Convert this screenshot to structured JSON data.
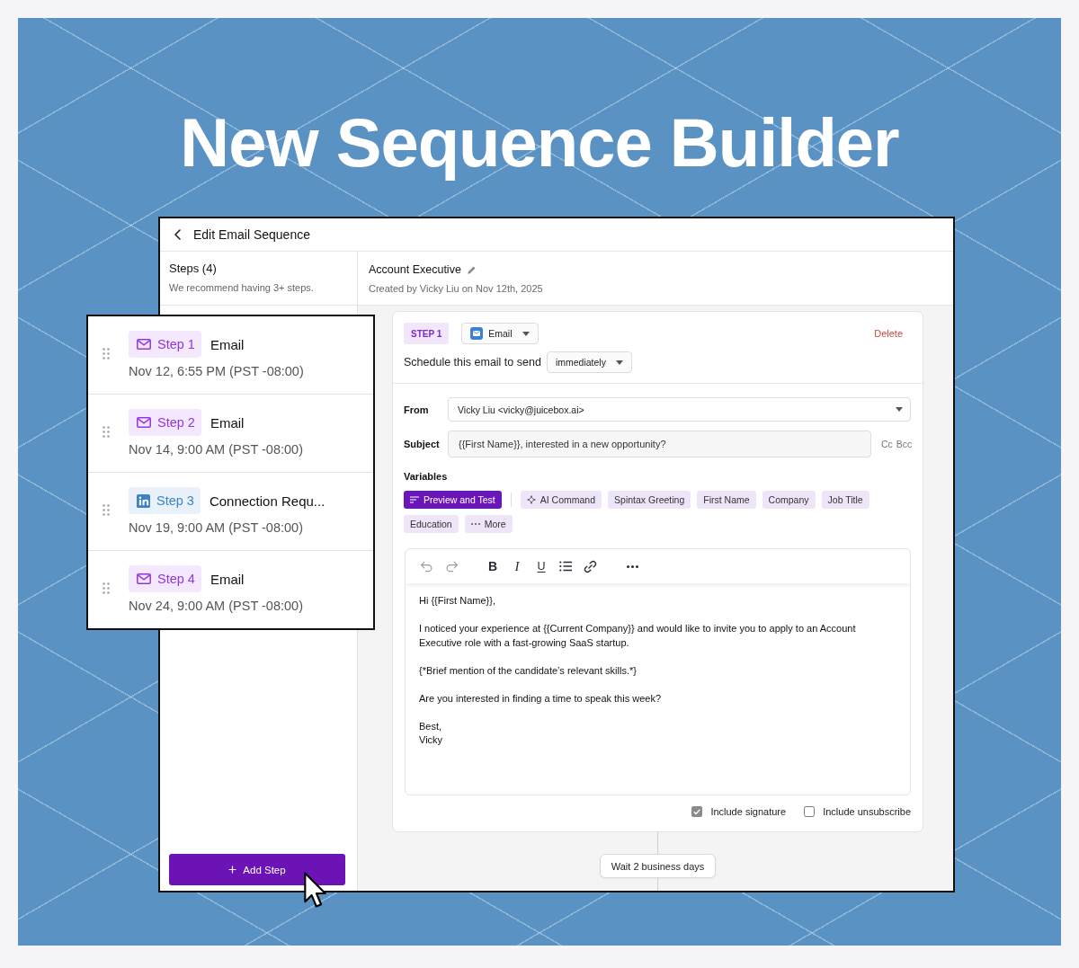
{
  "hero": {
    "title": "New Sequence Builder"
  },
  "window": {
    "title": "Edit Email Sequence"
  },
  "steps_panel": {
    "heading": "Steps (4)",
    "hint": "We recommend having 3+ steps.",
    "add_button": "Add Step"
  },
  "steps": [
    {
      "kind": "email",
      "label": "Step 1",
      "type": "Email",
      "scheduled": "Nov 12, 6:55 PM (PST -08:00)"
    },
    {
      "kind": "email",
      "label": "Step 2",
      "type": "Email",
      "scheduled": "Nov 14, 9:00 AM (PST -08:00)"
    },
    {
      "kind": "linkedin",
      "label": "Step 3",
      "type": "Connection Requ...",
      "scheduled": "Nov 19, 9:00 AM (PST -08:00)"
    },
    {
      "kind": "email",
      "label": "Step 4",
      "type": "Email",
      "scheduled": "Nov 24, 9:00 AM (PST -08:00)"
    }
  ],
  "sequence": {
    "title": "Account Executive",
    "created": "Created by Vicky Liu on Nov 12th, 2025"
  },
  "step_editor": {
    "tag": "STEP 1",
    "channel": "Email",
    "delete": "Delete",
    "schedule_label": "Schedule this email to send",
    "timing": "immediately",
    "from_label": "From",
    "from_value": "Vicky Liu <vicky@juicebox.ai>",
    "subject_label": "Subject",
    "subject_value": "{{First Name}}, interested in a new opportunity?",
    "cc": "Cc",
    "bcc": "Bcc",
    "variables_label": "Variables",
    "variables": [
      {
        "kind": "action",
        "label": "Preview and Test"
      },
      {
        "kind": "ai",
        "label": "AI Command"
      },
      {
        "kind": "variable",
        "label": "Spintax Greeting"
      },
      {
        "kind": "variable",
        "label": "First Name"
      },
      {
        "kind": "variable",
        "label": "Company"
      },
      {
        "kind": "variable",
        "label": "Job Title"
      },
      {
        "kind": "variable",
        "label": "Education"
      },
      {
        "kind": "more",
        "label": "More"
      }
    ],
    "toolbar": [
      {
        "kind": "undo",
        "disabled": true
      },
      {
        "kind": "redo",
        "disabled": true
      },
      {
        "kind": "bold",
        "label": "B",
        "disabled": false
      },
      {
        "kind": "italic",
        "label": "I",
        "disabled": false
      },
      {
        "kind": "underline",
        "label": "U",
        "disabled": false
      },
      {
        "kind": "bullets",
        "disabled": false
      },
      {
        "kind": "link",
        "disabled": false
      },
      {
        "kind": "more",
        "disabled": false
      }
    ],
    "body": [
      "Hi {{First Name}},",
      "I noticed your experience at {{Current Company}} and would like to invite you to apply to an Account Executive role with a fast-growing SaaS startup.",
      "{*Brief mention of the candidate’s relevant skills.*}",
      "Are you interested in finding a time to speak this week?",
      "Best,\nVicky"
    ],
    "options": [
      {
        "label": "Include signature",
        "checked": true
      },
      {
        "label": "Include unsubscribe",
        "checked": false
      }
    ]
  },
  "wait": {
    "label": "Wait 2 business days"
  }
}
